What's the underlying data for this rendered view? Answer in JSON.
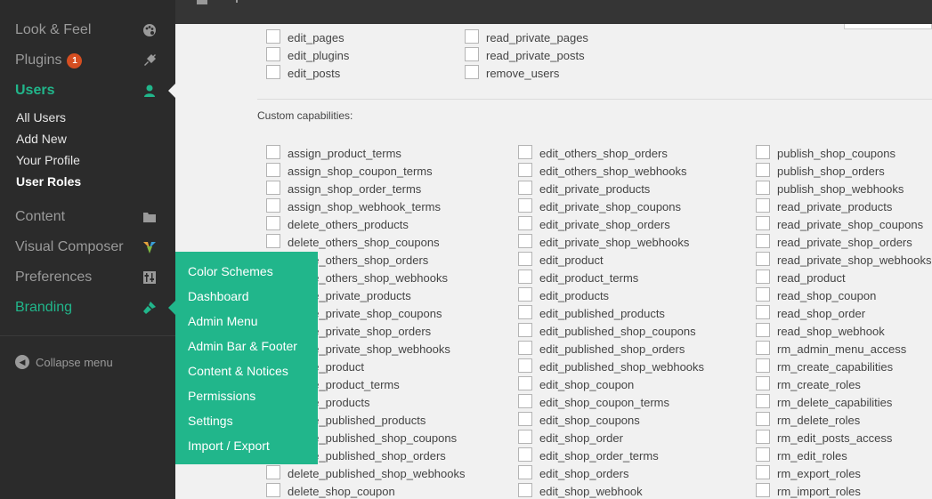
{
  "sidebar": {
    "menu": {
      "look_feel": {
        "label": "Look & Feel",
        "icon": "palette-icon"
      },
      "plugins": {
        "label": "Plugins",
        "badge": "1",
        "icon": "plug-icon"
      },
      "users": {
        "label": "Users",
        "icon": "user-icon"
      },
      "content": {
        "label": "Content",
        "icon": "folder-icon"
      },
      "visual_composer": {
        "label": "Visual Composer",
        "icon": "vc-logo-icon"
      },
      "preferences": {
        "label": "Preferences",
        "icon": "sliders-icon"
      },
      "branding": {
        "label": "Branding",
        "icon": "brush-icon"
      }
    },
    "users_submenu": [
      "All Users",
      "Add New",
      "Your Profile",
      "User Roles"
    ],
    "collapse_label": "Collapse menu"
  },
  "branding_flyout": [
    "Color Schemes",
    "Dashboard",
    "Admin Menu",
    "Admin Bar & Footer",
    "Content & Notices",
    "Permissions",
    "Settings",
    "Import / Export"
  ],
  "capabilities": {
    "core_col1": [
      "edit_pages",
      "edit_plugins",
      "edit_posts"
    ],
    "core_col2": [
      "read_private_pages",
      "read_private_posts",
      "remove_users"
    ],
    "custom_title": "Custom capabilities:",
    "custom_col1": [
      "assign_product_terms",
      "assign_shop_coupon_terms",
      "assign_shop_order_terms",
      "assign_shop_webhook_terms",
      "delete_others_products",
      "delete_others_shop_coupons",
      "delete_others_shop_orders",
      "delete_others_shop_webhooks",
      "delete_private_products",
      "delete_private_shop_coupons",
      "delete_private_shop_orders",
      "delete_private_shop_webhooks",
      "delete_product",
      "delete_product_terms",
      "delete_products",
      "delete_published_products",
      "delete_published_shop_coupons",
      "delete_published_shop_orders",
      "delete_published_shop_webhooks",
      "delete_shop_coupon"
    ],
    "custom_col2": [
      "edit_others_shop_orders",
      "edit_others_shop_webhooks",
      "edit_private_products",
      "edit_private_shop_coupons",
      "edit_private_shop_orders",
      "edit_private_shop_webhooks",
      "edit_product",
      "edit_product_terms",
      "edit_products",
      "edit_published_products",
      "edit_published_shop_coupons",
      "edit_published_shop_orders",
      "edit_published_shop_webhooks",
      "edit_shop_coupon",
      "edit_shop_coupon_terms",
      "edit_shop_coupons",
      "edit_shop_order",
      "edit_shop_order_terms",
      "edit_shop_orders",
      "edit_shop_webhook"
    ],
    "custom_col3": [
      "publish_shop_coupons",
      "publish_shop_orders",
      "publish_shop_webhooks",
      "read_private_products",
      "read_private_shop_coupons",
      "read_private_shop_orders",
      "read_private_shop_webhooks",
      "read_product",
      "read_shop_coupon",
      "read_shop_order",
      "read_shop_webhook",
      "rm_admin_menu_access",
      "rm_create_capabilities",
      "rm_create_roles",
      "rm_delete_capabilities",
      "rm_delete_roles",
      "rm_edit_posts_access",
      "rm_edit_roles",
      "rm_export_roles",
      "rm_import_roles"
    ]
  },
  "colors": {
    "accent": "#21b68b",
    "sidebar_bg": "#2b2b2b",
    "badge": "#d54e21"
  }
}
